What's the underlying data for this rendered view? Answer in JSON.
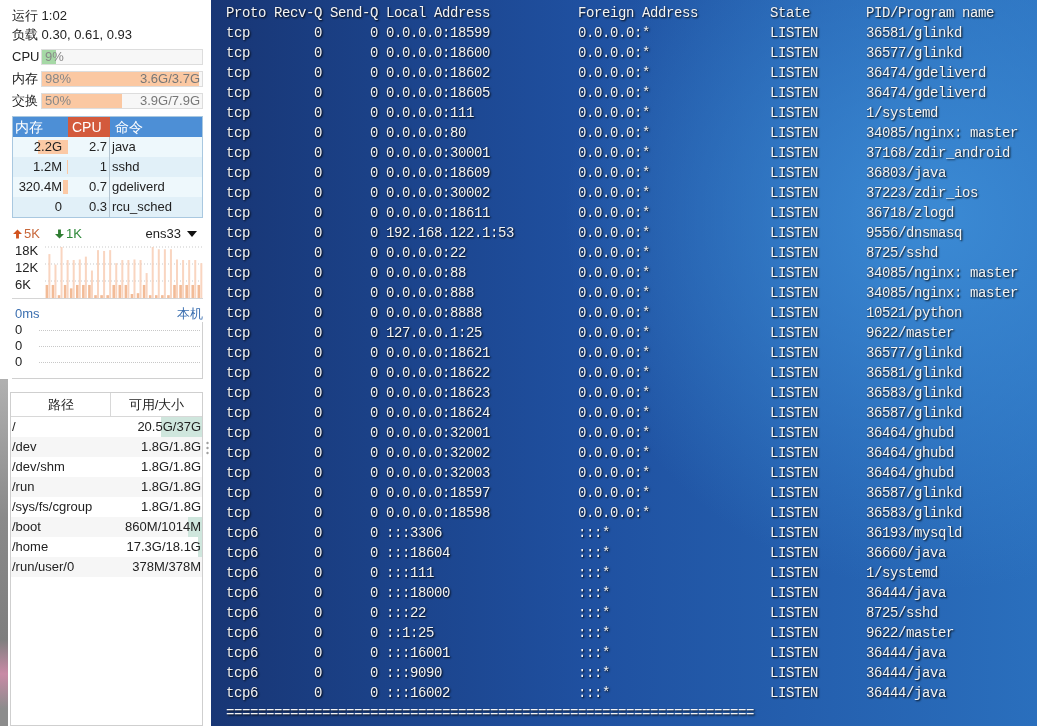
{
  "status": {
    "uptime": "运行 1:02",
    "load": "负载 0.30, 0.61, 0.93"
  },
  "meters": [
    {
      "label": "CPU",
      "percent": "9%",
      "level": 0.09,
      "color": "#a6d9a6"
    },
    {
      "label": "内存",
      "percent": "98%",
      "detail": "3.6G/3.7G",
      "level": 0.98,
      "color": "#fbc8a2"
    },
    {
      "label": "交换",
      "percent": "50%",
      "detail": "3.9G/7.9G",
      "level": 0.5,
      "color": "#fbc8a2"
    }
  ],
  "processes": {
    "columns": [
      {
        "label": "内存",
        "sorted": false
      },
      {
        "label": "CPU",
        "sorted": true
      },
      {
        "label": "命令",
        "sorted": false
      }
    ],
    "rows": [
      {
        "memory": "2.2G",
        "level": 0.55,
        "cpu": "2.7",
        "command": "java"
      },
      {
        "memory": "1.2M",
        "level": 0.02,
        "cpu": "1",
        "command": "sshd"
      },
      {
        "memory": "320.4M",
        "level": 0.09,
        "cpu": "0.7",
        "command": "gdeliverd"
      },
      {
        "memory": "0",
        "cpu": "0.3",
        "command": "rcu_sched"
      }
    ]
  },
  "network": {
    "upload": "5K",
    "download": "1K",
    "interface": "ens33",
    "chart_data": {
      "type": "bar",
      "grid": true,
      "ylim": [
        0,
        18
      ],
      "yticks": [
        {
          "value": 6,
          "label": "6K"
        },
        {
          "value": 12,
          "label": "12K"
        },
        {
          "value": 18,
          "label": "18K"
        }
      ],
      "series": [
        {
          "color": "#f2bb97",
          "values": [
            4.6,
            4.6,
            1,
            4.6,
            3.4,
            4.6,
            4.6,
            4.6,
            1,
            1,
            1,
            4.6,
            4.6,
            4.6,
            1.4,
            1.7,
            4.6,
            1,
            1,
            1,
            1,
            4.6,
            4.6,
            4.6,
            4.6,
            4.6
          ]
        },
        {
          "color": "#f9d5c0",
          "values": [
            15.5,
            11.8,
            18,
            13.4,
            13.4,
            13.6,
            14.6,
            9.7,
            16.9,
            16.6,
            16.9,
            12.3,
            13.4,
            13.4,
            13.6,
            13.4,
            8.8,
            18,
            17.2,
            17.2,
            17.2,
            13.6,
            13.4,
            13.4,
            13.4,
            12.3
          ]
        }
      ]
    }
  },
  "latency": {
    "value": "0ms",
    "host": "本机",
    "axis": [
      "0",
      "0",
      "0"
    ]
  },
  "disks": {
    "columns": [
      "路径",
      "可用/大小"
    ],
    "rows": [
      {
        "path": "/",
        "usage": "20.5G/37G",
        "level": 0.45
      },
      {
        "path": "/dev",
        "usage": "1.8G/1.8G"
      },
      {
        "path": "/dev/shm",
        "usage": "1.8G/1.8G"
      },
      {
        "path": "/run",
        "usage": "1.8G/1.8G"
      },
      {
        "path": "/sys/fs/cgroup",
        "usage": "1.8G/1.8G"
      },
      {
        "path": "/boot",
        "usage": "860M/1014M",
        "level": 0.15
      },
      {
        "path": "/home",
        "usage": "17.3G/18.1G",
        "level": 0.04
      },
      {
        "path": "/run/user/0",
        "usage": "378M/378M"
      }
    ]
  },
  "terminal": {
    "columns": [
      "Proto",
      "Recv-Q",
      "Send-Q",
      "Local Address",
      "Foreign Address",
      "State",
      "PID/Program name"
    ],
    "rows": [
      [
        "tcp",
        "0",
        "0",
        "0.0.0.0:18599",
        "0.0.0.0:*",
        "LISTEN",
        "36581/glinkd"
      ],
      [
        "tcp",
        "0",
        "0",
        "0.0.0.0:18600",
        "0.0.0.0:*",
        "LISTEN",
        "36577/glinkd"
      ],
      [
        "tcp",
        "0",
        "0",
        "0.0.0.0:18602",
        "0.0.0.0:*",
        "LISTEN",
        "36474/gdeliverd"
      ],
      [
        "tcp",
        "0",
        "0",
        "0.0.0.0:18605",
        "0.0.0.0:*",
        "LISTEN",
        "36474/gdeliverd"
      ],
      [
        "tcp",
        "0",
        "0",
        "0.0.0.0:111",
        "0.0.0.0:*",
        "LISTEN",
        "1/systemd"
      ],
      [
        "tcp",
        "0",
        "0",
        "0.0.0.0:80",
        "0.0.0.0:*",
        "LISTEN",
        "34085/nginx: master"
      ],
      [
        "tcp",
        "0",
        "0",
        "0.0.0.0:30001",
        "0.0.0.0:*",
        "LISTEN",
        "37168/zdir_android"
      ],
      [
        "tcp",
        "0",
        "0",
        "0.0.0.0:18609",
        "0.0.0.0:*",
        "LISTEN",
        "36803/java"
      ],
      [
        "tcp",
        "0",
        "0",
        "0.0.0.0:30002",
        "0.0.0.0:*",
        "LISTEN",
        "37223/zdir_ios"
      ],
      [
        "tcp",
        "0",
        "0",
        "0.0.0.0:18611",
        "0.0.0.0:*",
        "LISTEN",
        "36718/zlogd"
      ],
      [
        "tcp",
        "0",
        "0",
        "192.168.122.1:53",
        "0.0.0.0:*",
        "LISTEN",
        "9556/dnsmasq"
      ],
      [
        "tcp",
        "0",
        "0",
        "0.0.0.0:22",
        "0.0.0.0:*",
        "LISTEN",
        "8725/sshd"
      ],
      [
        "tcp",
        "0",
        "0",
        "0.0.0.0:88",
        "0.0.0.0:*",
        "LISTEN",
        "34085/nginx: master"
      ],
      [
        "tcp",
        "0",
        "0",
        "0.0.0.0:888",
        "0.0.0.0:*",
        "LISTEN",
        "34085/nginx: master"
      ],
      [
        "tcp",
        "0",
        "0",
        "0.0.0.0:8888",
        "0.0.0.0:*",
        "LISTEN",
        "10521/python"
      ],
      [
        "tcp",
        "0",
        "0",
        "127.0.0.1:25",
        "0.0.0.0:*",
        "LISTEN",
        "9622/master"
      ],
      [
        "tcp",
        "0",
        "0",
        "0.0.0.0:18621",
        "0.0.0.0:*",
        "LISTEN",
        "36577/glinkd"
      ],
      [
        "tcp",
        "0",
        "0",
        "0.0.0.0:18622",
        "0.0.0.0:*",
        "LISTEN",
        "36581/glinkd"
      ],
      [
        "tcp",
        "0",
        "0",
        "0.0.0.0:18623",
        "0.0.0.0:*",
        "LISTEN",
        "36583/glinkd"
      ],
      [
        "tcp",
        "0",
        "0",
        "0.0.0.0:18624",
        "0.0.0.0:*",
        "LISTEN",
        "36587/glinkd"
      ],
      [
        "tcp",
        "0",
        "0",
        "0.0.0.0:32001",
        "0.0.0.0:*",
        "LISTEN",
        "36464/ghubd"
      ],
      [
        "tcp",
        "0",
        "0",
        "0.0.0.0:32002",
        "0.0.0.0:*",
        "LISTEN",
        "36464/ghubd"
      ],
      [
        "tcp",
        "0",
        "0",
        "0.0.0.0:32003",
        "0.0.0.0:*",
        "LISTEN",
        "36464/ghubd"
      ],
      [
        "tcp",
        "0",
        "0",
        "0.0.0.0:18597",
        "0.0.0.0:*",
        "LISTEN",
        "36587/glinkd"
      ],
      [
        "tcp",
        "0",
        "0",
        "0.0.0.0:18598",
        "0.0.0.0:*",
        "LISTEN",
        "36583/glinkd"
      ],
      [
        "tcp6",
        "0",
        "0",
        ":::3306",
        ":::*",
        "LISTEN",
        "36193/mysqld"
      ],
      [
        "tcp6",
        "0",
        "0",
        ":::18604",
        ":::*",
        "LISTEN",
        "36660/java"
      ],
      [
        "tcp6",
        "0",
        "0",
        ":::111",
        ":::*",
        "LISTEN",
        "1/systemd"
      ],
      [
        "tcp6",
        "0",
        "0",
        ":::18000",
        ":::*",
        "LISTEN",
        "36444/java"
      ],
      [
        "tcp6",
        "0",
        "0",
        ":::22",
        ":::*",
        "LISTEN",
        "8725/sshd"
      ],
      [
        "tcp6",
        "0",
        "0",
        "::1:25",
        ":::*",
        "LISTEN",
        "9622/master"
      ],
      [
        "tcp6",
        "0",
        "0",
        ":::16001",
        ":::*",
        "LISTEN",
        "36444/java"
      ],
      [
        "tcp6",
        "0",
        "0",
        ":::9090",
        ":::*",
        "LISTEN",
        "36444/java"
      ],
      [
        "tcp6",
        "0",
        "0",
        ":::16002",
        ":::*",
        "LISTEN",
        "36444/java"
      ]
    ],
    "separator": "=================================================================="
  }
}
